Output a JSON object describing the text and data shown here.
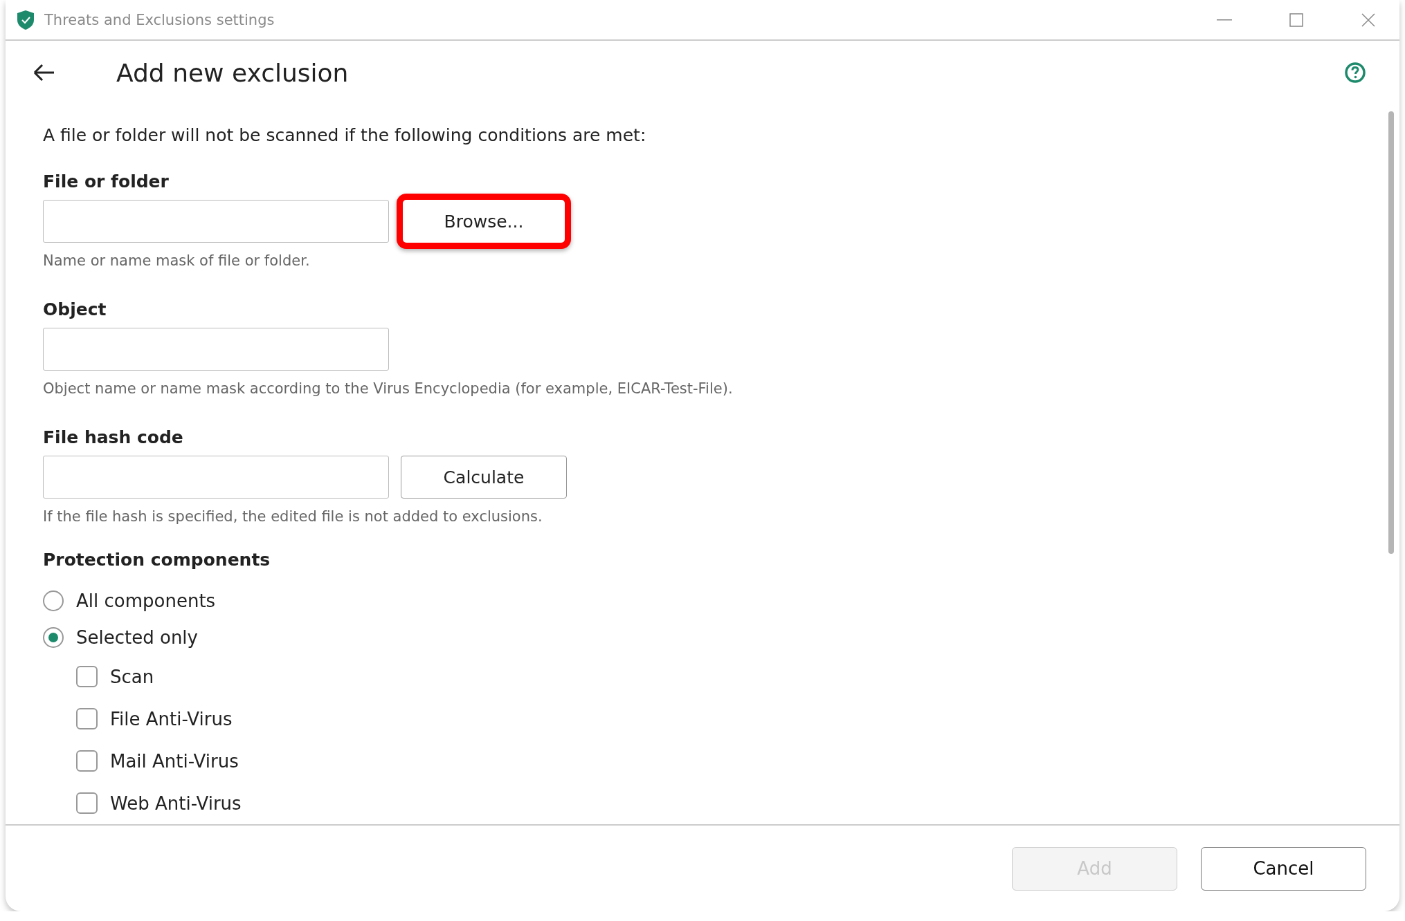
{
  "window": {
    "title": "Threats and Exclusions settings"
  },
  "header": {
    "title": "Add new exclusion"
  },
  "intro": "A file or folder will not be scanned if the following conditions are met:",
  "fields": [
    {
      "label": "File or folder",
      "hint": "Name or name mask of file or folder.",
      "button": {
        "label": "Browse...",
        "highlighted": true
      }
    },
    {
      "label": "Object",
      "hint": "Object name or name mask according to the Virus Encyclopedia (for example, EICAR-Test-File)."
    },
    {
      "label": "File hash code",
      "hint": "If the file hash is specified, the edited file is not added to exclusions.",
      "button": {
        "label": "Calculate",
        "highlighted": false
      }
    }
  ],
  "protection": {
    "title": "Protection components",
    "options": [
      {
        "label": "All components",
        "selected": false
      },
      {
        "label": "Selected only",
        "selected": true
      }
    ],
    "components": [
      {
        "label": "Scan",
        "checked": false
      },
      {
        "label": "File Anti-Virus",
        "checked": false
      },
      {
        "label": "Mail Anti-Virus",
        "checked": false
      },
      {
        "label": "Web Anti-Virus",
        "checked": false
      }
    ]
  },
  "footer": {
    "buttons": [
      {
        "label": "Add",
        "disabled": true
      },
      {
        "label": "Cancel",
        "disabled": false
      }
    ]
  }
}
